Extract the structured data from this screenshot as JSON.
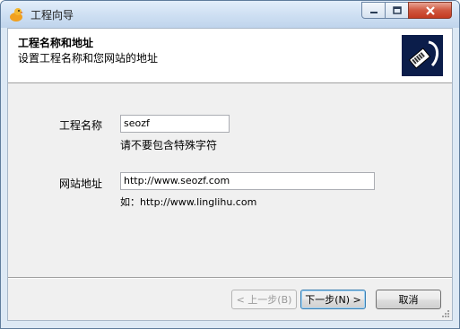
{
  "window": {
    "title": "工程向导"
  },
  "header": {
    "title": "工程名称和地址",
    "subtitle": "设置工程名称和您网站的地址"
  },
  "form": {
    "name_label": "工程名称",
    "name_value": "seozf",
    "name_hint": "请不要包含特殊字符",
    "url_label": "网站地址",
    "url_value": "http://www.seozf.com",
    "url_hint": "如：http://www.linglihu.com"
  },
  "buttons": {
    "back": "< 上一步(B)",
    "next": "下一步(N) >",
    "cancel": "取消"
  },
  "colors": {
    "close_button": "#c43a20",
    "header_image_bg": "#0b1d4a",
    "default_button_border": "#3c7fb1"
  }
}
